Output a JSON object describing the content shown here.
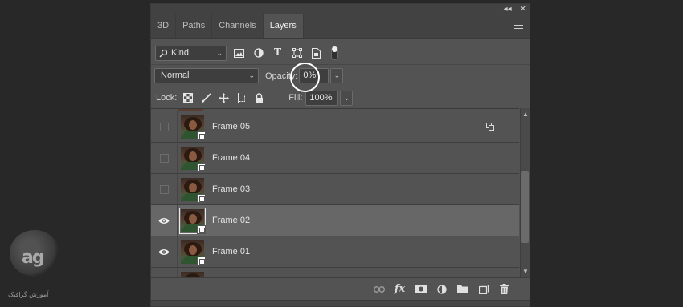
{
  "panel": {
    "title_icons": [
      "collapse-icon",
      "close-icon"
    ],
    "tabs": [
      {
        "label": "3D",
        "active": false
      },
      {
        "label": "Paths",
        "active": false
      },
      {
        "label": "Channels",
        "active": false
      },
      {
        "label": "Layers",
        "active": true
      }
    ]
  },
  "filter": {
    "kind_label": "Kind",
    "icons": [
      "pixel-layer-filter-icon",
      "adjustment-layer-filter-icon",
      "type-layer-filter-icon",
      "shape-layer-filter-icon",
      "smart-object-filter-icon"
    ]
  },
  "blend": {
    "mode": "Normal",
    "opacity_label": "Opacity:",
    "opacity_value": "0%"
  },
  "lock": {
    "label": "Lock:",
    "icons": [
      "lock-transparent-pixels-icon",
      "lock-image-pixels-icon",
      "lock-position-icon",
      "lock-artboard-icon",
      "lock-all-icon"
    ],
    "fill_label": "Fill:",
    "fill_value": "100%"
  },
  "layers": [
    {
      "name": "Frame 05",
      "visible": false,
      "selected": false,
      "badge": "layer-link-badge-icon"
    },
    {
      "name": "Frame 04",
      "visible": false,
      "selected": false
    },
    {
      "name": "Frame 03",
      "visible": false,
      "selected": false
    },
    {
      "name": "Frame 02",
      "visible": true,
      "selected": true
    },
    {
      "name": "Frame 01",
      "visible": true,
      "selected": false
    }
  ],
  "footer_icons": [
    "link-layers-icon",
    "fx-icon",
    "add-mask-icon",
    "new-adjustment-icon",
    "new-group-icon",
    "new-layer-icon",
    "trash-icon"
  ],
  "footer": {
    "fx_label": "fx"
  },
  "colors": {
    "panel_bg": "#535353",
    "tab_bar": "#424242",
    "selected_row": "#676767",
    "highlight_circle": "#ffffff"
  }
}
